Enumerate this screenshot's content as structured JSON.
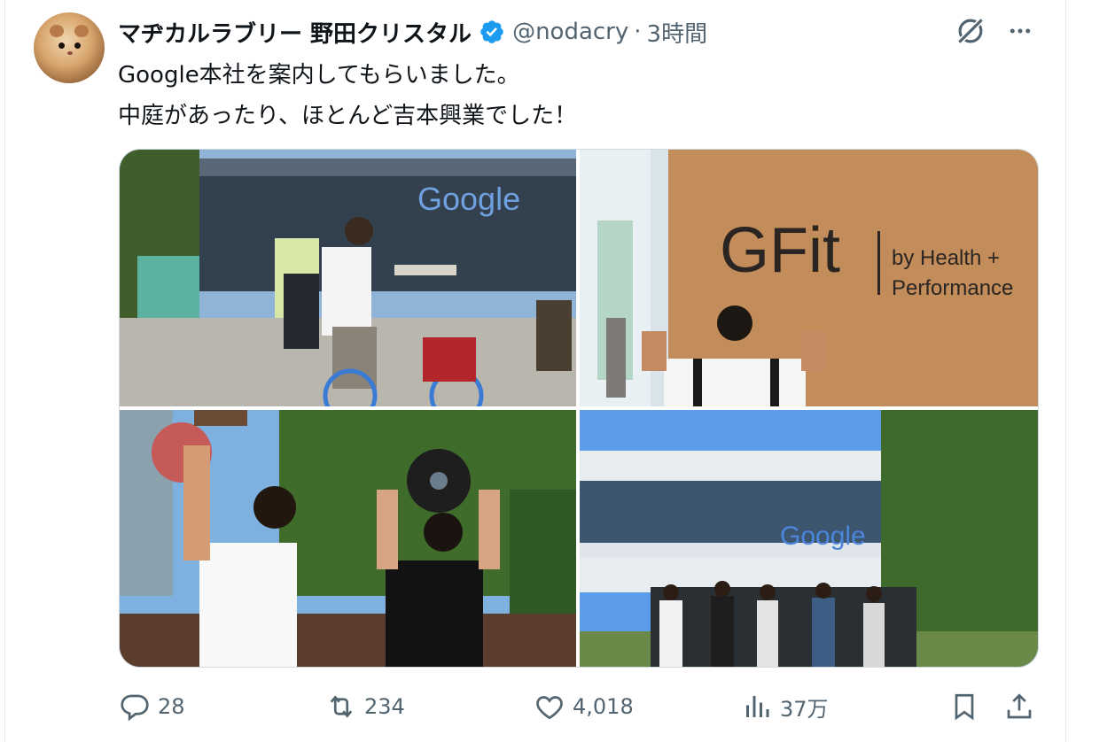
{
  "tweet": {
    "display_name": "マヂカルラブリー 野田クリスタル",
    "verified_icon": "verified-badge-icon",
    "handle": "@nodacry",
    "separator": "·",
    "time": "3時間",
    "text_lines": [
      "Google本社を案内してもらいました。",
      "中庭があったり、ほとんど吉本興業でした！"
    ]
  },
  "media": {
    "photo_1_sign_text": "Google",
    "photo_2_sign_title": "GFit",
    "photo_2_sign_sub": [
      "by Health +",
      "Performance"
    ],
    "photo_4_sign_text": "Google"
  },
  "actions": {
    "reply_count": "28",
    "retweet_count": "234",
    "like_count": "4,018",
    "views_count": "37万"
  },
  "colors": {
    "text_primary": "#0f1419",
    "text_secondary": "#536471",
    "verified_blue": "#1d9bf0",
    "border": "#cfd9de"
  },
  "icons": [
    "grok-icon",
    "more-icon",
    "reply-icon",
    "retweet-icon",
    "like-icon",
    "views-icon",
    "bookmark-icon",
    "share-icon"
  ]
}
